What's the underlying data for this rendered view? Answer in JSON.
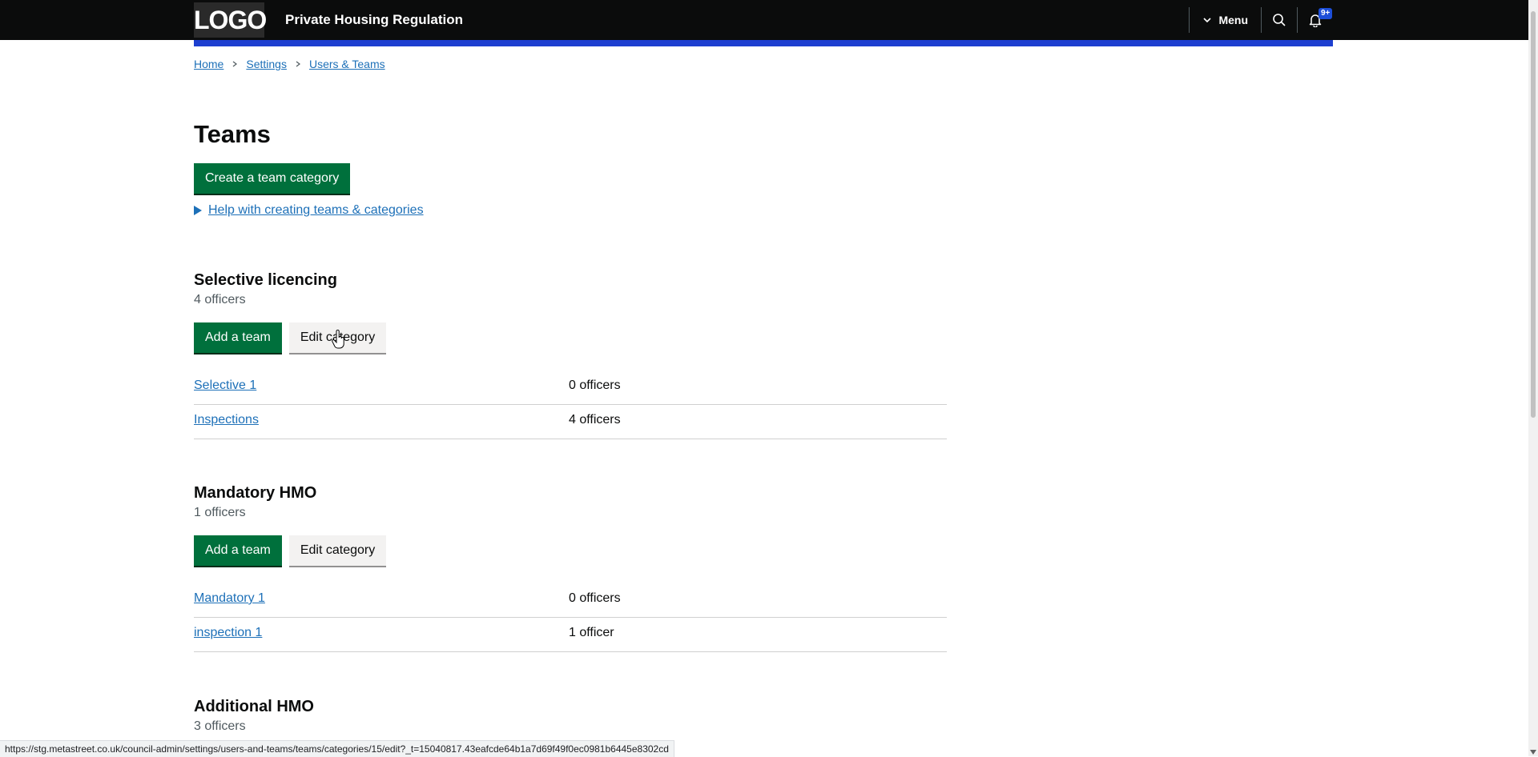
{
  "header": {
    "logo": "LOGO",
    "service_name": "Private Housing Regulation",
    "menu_label": "Menu",
    "notification_count": "9+"
  },
  "breadcrumb": [
    {
      "label": "Home"
    },
    {
      "label": "Settings"
    },
    {
      "label": "Users & Teams"
    }
  ],
  "page": {
    "title": "Teams",
    "create_button": "Create a team category",
    "help_link": "Help with creating teams & categories"
  },
  "categories": [
    {
      "name": "Selective licencing",
      "count": "4 officers",
      "add_button": "Add a team",
      "edit_button": "Edit category",
      "teams": [
        {
          "name": "Selective 1",
          "officers": "0 officers"
        },
        {
          "name": "Inspections",
          "officers": "4 officers"
        }
      ]
    },
    {
      "name": "Mandatory HMO",
      "count": "1 officers",
      "add_button": "Add a team",
      "edit_button": "Edit category",
      "teams": [
        {
          "name": "Mandatory 1",
          "officers": "0 officers"
        },
        {
          "name": "inspection 1",
          "officers": "1 officer"
        }
      ]
    },
    {
      "name": "Additional HMO",
      "count": "3 officers"
    }
  ],
  "status_bar": {
    "url": "https://stg.metastreet.co.uk/council-admin/settings/users-and-teams/teams/categories/15/edit?_t=15040817.43eafcde64b1a7d69f49f0ec0981b6445e8302cd"
  },
  "colors": {
    "header_bg": "#0b0c0c",
    "accent_bar": "#1d3fd0",
    "primary_button": "#00703c",
    "link": "#1d70b8"
  }
}
